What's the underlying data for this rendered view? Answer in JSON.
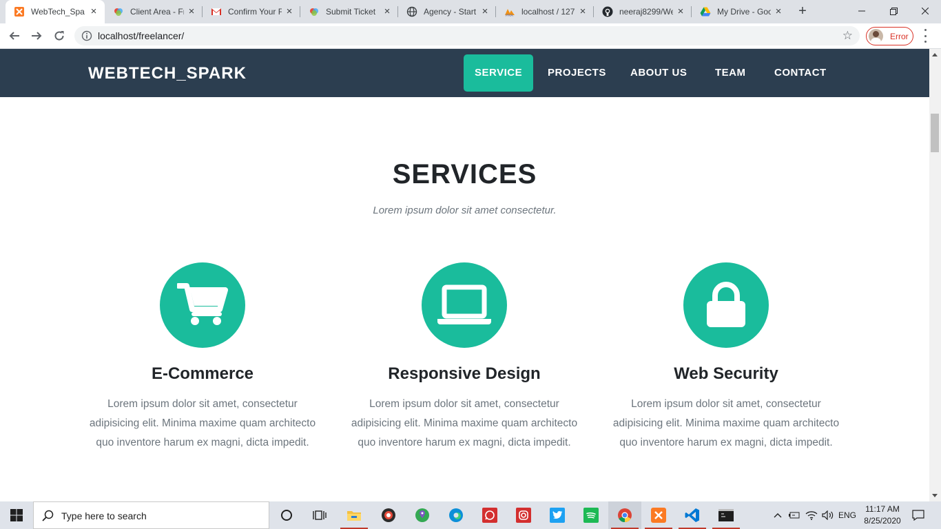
{
  "browser": {
    "tabs": [
      {
        "title": "WebTech_Spark",
        "icon": "xampp-icon",
        "active": true
      },
      {
        "title": "Client Area - Fr",
        "icon": "client-area-icon"
      },
      {
        "title": "Confirm Your F",
        "icon": "gmail-icon"
      },
      {
        "title": "Submit Ticket",
        "icon": "submit-ticket-icon"
      },
      {
        "title": "Agency - Start",
        "icon": "globe-icon"
      },
      {
        "title": "localhost / 127",
        "icon": "phpmyadmin-icon"
      },
      {
        "title": "neeraj8299/We",
        "icon": "github-icon"
      },
      {
        "title": "My Drive - Goo",
        "icon": "google-drive-icon"
      }
    ],
    "url": "localhost/freelancer/",
    "profile_status": "Error"
  },
  "site": {
    "brand": "WEBTECH_SPARK",
    "nav": [
      {
        "label": "SERVICE",
        "active": true
      },
      {
        "label": "PROJECTS"
      },
      {
        "label": "ABOUT US"
      },
      {
        "label": "TEAM"
      },
      {
        "label": "CONTACT"
      }
    ],
    "section_title": "SERVICES",
    "section_subtitle": "Lorem ipsum dolor sit amet consectetur.",
    "services": [
      {
        "icon": "shopping-cart-icon",
        "title": "E-Commerce",
        "text": "Lorem ipsum dolor sit amet, consectetur adipisicing elit. Minima maxime quam architecto quo inventore harum ex magni, dicta impedit."
      },
      {
        "icon": "laptop-icon",
        "title": "Responsive Design",
        "text": "Lorem ipsum dolor sit amet, consectetur adipisicing elit. Minima maxime quam architecto quo inventore harum ex magni, dicta impedit."
      },
      {
        "icon": "lock-icon",
        "title": "Web Security",
        "text": "Lorem ipsum dolor sit amet, consectetur adipisicing elit. Minima maxime quam architecto quo inventore harum ex magni, dicta impedit."
      }
    ],
    "colors": {
      "navbar": "#2c3e50",
      "accent": "#1abc9c",
      "heading": "#212529",
      "muted": "#6c757d"
    }
  },
  "taskbar": {
    "search_placeholder": "Type here to search",
    "language": "ENG",
    "time": "11:17 AM",
    "date": "8/25/2020"
  }
}
